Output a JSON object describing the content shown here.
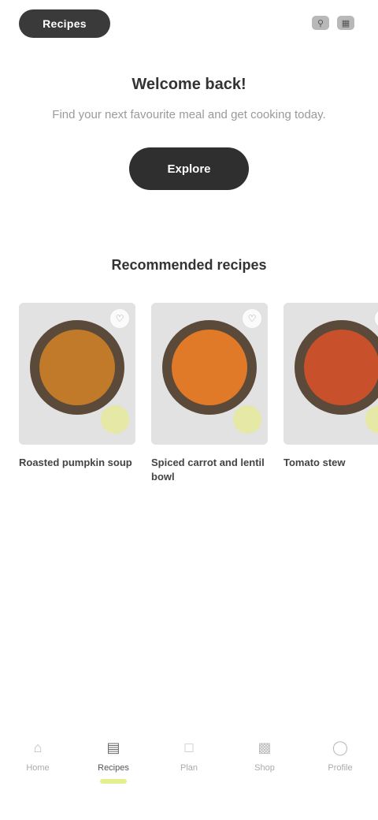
{
  "header": {
    "brand_label": "Recipes",
    "icons": [
      "search-icon",
      "cart-icon"
    ]
  },
  "hero": {
    "title": "Welcome back!",
    "subtitle": "Find your next favourite meal and get cooking today.",
    "cta_label": "Explore"
  },
  "section": {
    "title": "Recommended recipes"
  },
  "cards": [
    {
      "title": "Roasted pumpkin soup",
      "food_color": "#c07a2a",
      "favorite_icon": "heart-icon"
    },
    {
      "title": "Spiced carrot and lentil bowl",
      "food_color": "#e07a28",
      "favorite_icon": "heart-icon"
    },
    {
      "title": "Tomato stew",
      "food_color": "#c8502a",
      "favorite_icon": "heart-icon"
    }
  ],
  "nav": [
    {
      "label": "Home",
      "icon": "home-icon",
      "active": false
    },
    {
      "label": "Recipes",
      "icon": "book-icon",
      "active": true
    },
    {
      "label": "Plan",
      "icon": "calendar-icon",
      "active": false
    },
    {
      "label": "Shop",
      "icon": "bag-icon",
      "active": false
    },
    {
      "label": "Profile",
      "icon": "user-icon",
      "active": false
    }
  ]
}
